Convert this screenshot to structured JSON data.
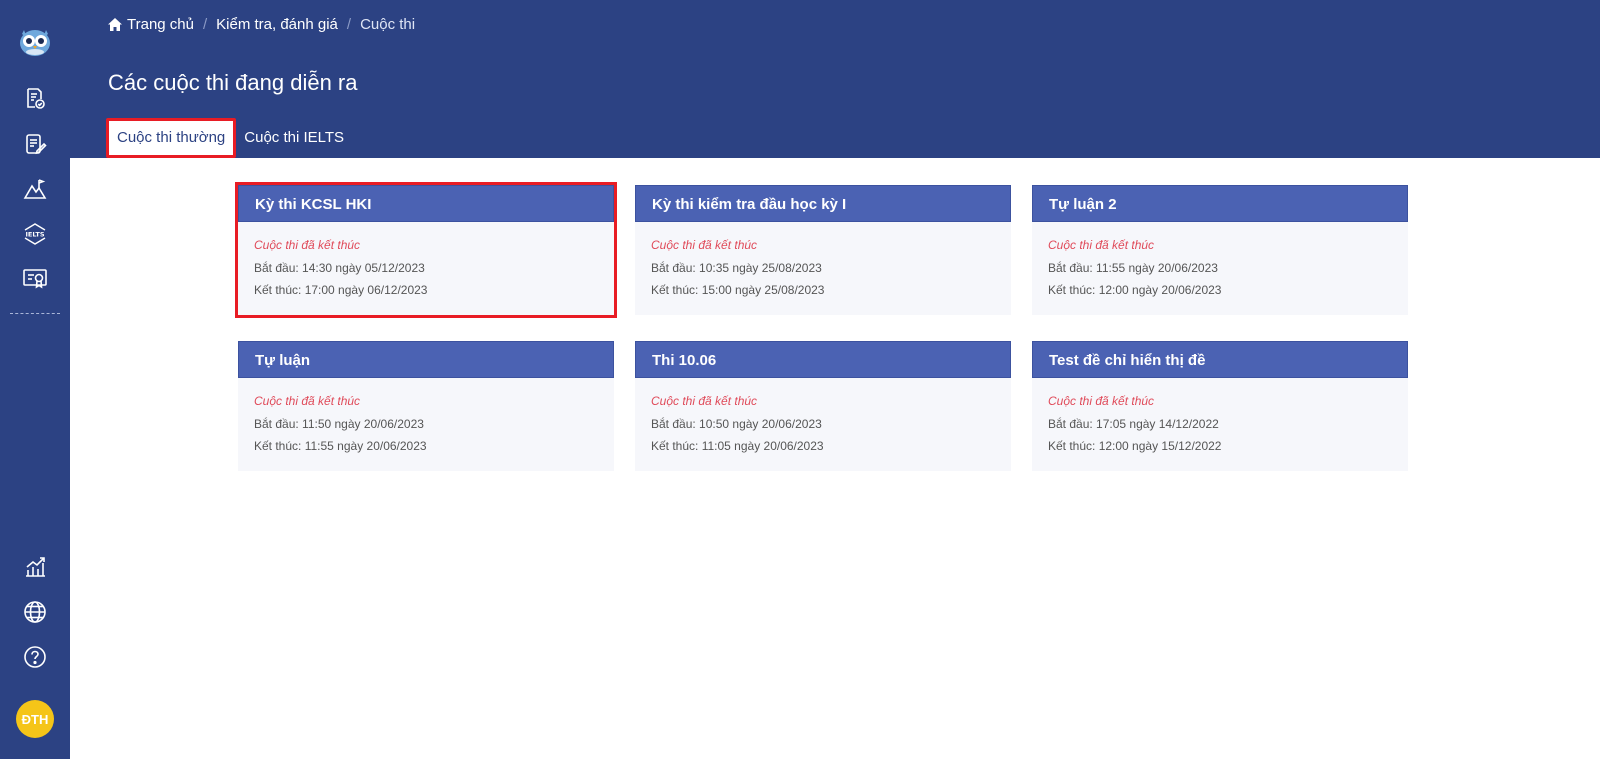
{
  "sidebar": {
    "avatar_initials": "ĐTH",
    "icons": [
      "owl-logo-icon",
      "exam-check-icon",
      "exam-edit-icon",
      "mountain-flag-icon",
      "ielts-icon",
      "certificate-icon",
      "chart-icon",
      "globe-icon",
      "help-icon"
    ]
  },
  "breadcrumb": {
    "home": "Trang chủ",
    "section": "Kiểm tra, đánh giá",
    "current": "Cuộc thi",
    "separator": "/"
  },
  "page_title": "Các cuộc thi đang diễn ra",
  "tabs": [
    {
      "label": "Cuộc thi thường",
      "active": true
    },
    {
      "label": "Cuộc thi IELTS",
      "active": false
    }
  ],
  "cards": [
    {
      "title": "Kỳ thi KCSL HKI",
      "status": "Cuộc thi đã kết thúc",
      "start": "Bắt đầu: 14:30 ngày 05/12/2023",
      "end": "Kết thúc: 17:00 ngày 06/12/2023"
    },
    {
      "title": "Kỳ thi kiểm tra đầu học kỳ I",
      "status": "Cuộc thi đã kết thúc",
      "start": "Bắt đầu: 10:35 ngày 25/08/2023",
      "end": "Kết thúc: 15:00 ngày 25/08/2023"
    },
    {
      "title": "Tự luận 2",
      "status": "Cuộc thi đã kết thúc",
      "start": "Bắt đầu: 11:55 ngày 20/06/2023",
      "end": "Kết thúc: 12:00 ngày 20/06/2023"
    },
    {
      "title": "Tự luận",
      "status": "Cuộc thi đã kết thúc",
      "start": "Bắt đầu: 11:50 ngày 20/06/2023",
      "end": "Kết thúc: 11:55 ngày 20/06/2023"
    },
    {
      "title": "Thi 10.06",
      "status": "Cuộc thi đã kết thúc",
      "start": "Bắt đầu: 10:50 ngày 20/06/2023",
      "end": "Kết thúc: 11:05 ngày 20/06/2023"
    },
    {
      "title": "Test đề chỉ hiển thị đề",
      "status": "Cuộc thi đã kết thúc",
      "start": "Bắt đầu: 17:05 ngày 14/12/2022",
      "end": "Kết thúc: 12:00 ngày 15/12/2022"
    }
  ],
  "colors": {
    "primary": "#2c4283",
    "card_header": "#4b62b3",
    "status_red": "#e04b5a",
    "highlight_red": "#e81c24",
    "avatar": "#f5c518"
  }
}
